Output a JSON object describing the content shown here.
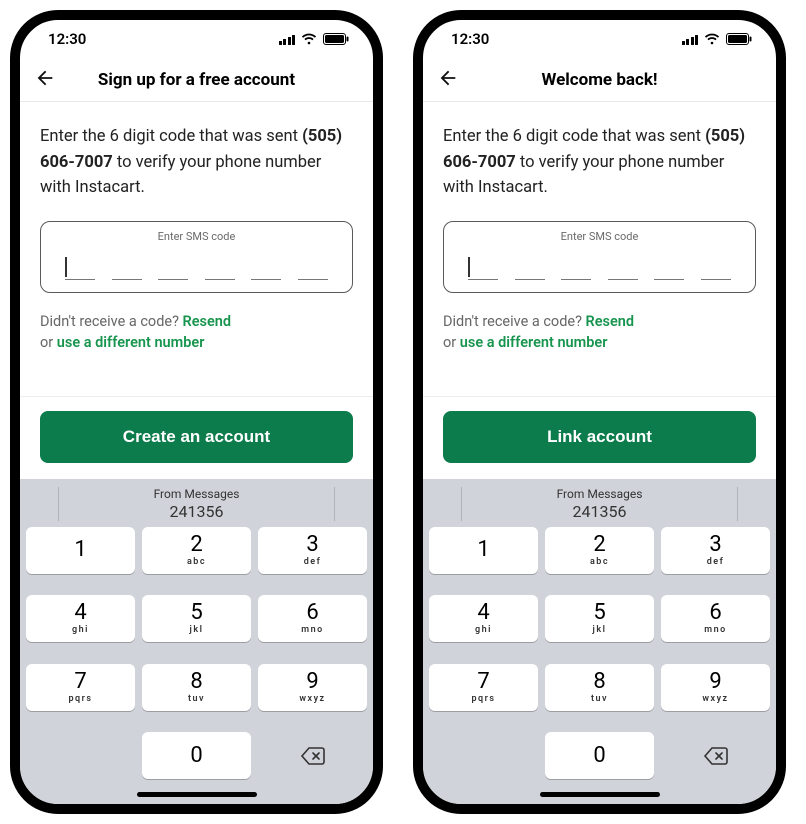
{
  "status": {
    "time": "12:30"
  },
  "screens": [
    {
      "title": "Sign up for a free account",
      "instruction_pre": "Enter the 6 digit code that was sent ",
      "instruction_phone": "(505) 606-7007",
      "instruction_post": " to verify your phone number with Instacart.",
      "code_label": "Enter SMS code",
      "resend_prefix": "Didn't receive a code? ",
      "resend_link": "Resend",
      "or_text": "or ",
      "diff_number": "use a different number",
      "cta": "Create an account"
    },
    {
      "title": "Welcome back!",
      "instruction_pre": "Enter the 6 digit code that was sent ",
      "instruction_phone": "(505) 606-7007",
      "instruction_post": " to verify your phone number with Instacart.",
      "code_label": "Enter SMS code",
      "resend_prefix": "Didn't receive a code? ",
      "resend_link": "Resend",
      "or_text": "or ",
      "diff_number": "use a different number",
      "cta": "Link account"
    }
  ],
  "keyboard": {
    "suggestion_from": "From Messages",
    "suggestion_code": "241356",
    "keys": [
      {
        "n": "1",
        "l": ""
      },
      {
        "n": "2",
        "l": "abc"
      },
      {
        "n": "3",
        "l": "def"
      },
      {
        "n": "4",
        "l": "ghi"
      },
      {
        "n": "5",
        "l": "jkl"
      },
      {
        "n": "6",
        "l": "mno"
      },
      {
        "n": "7",
        "l": "pqrs"
      },
      {
        "n": "8",
        "l": "tuv"
      },
      {
        "n": "9",
        "l": "wxyz"
      }
    ],
    "zero": "0"
  }
}
